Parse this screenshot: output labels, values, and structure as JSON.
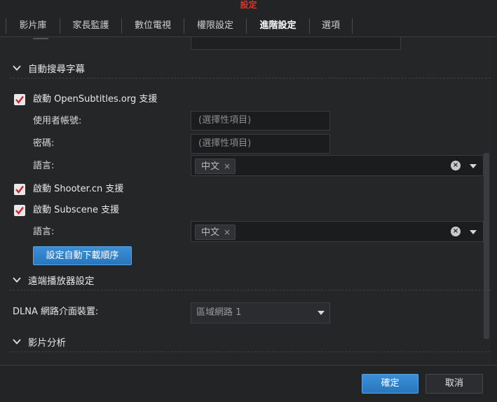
{
  "window": {
    "title": "設定"
  },
  "tabs": [
    {
      "label": "影片庫"
    },
    {
      "label": "家長監護"
    },
    {
      "label": "數位電視"
    },
    {
      "label": "權限設定"
    },
    {
      "label": "進階設定"
    },
    {
      "label": "選項"
    }
  ],
  "active_tab": "進階設定",
  "sections": {
    "auto_subtitle": {
      "title": "自動搜尋字幕"
    },
    "remote_player": {
      "title": "遠端播放器設定"
    },
    "video_analysis": {
      "title": "影片分析"
    }
  },
  "opensubtitles": {
    "checkbox_label": "啟動 OpenSubtitles.org 支援",
    "checked": true,
    "username_label": "使用者帳號:",
    "username_placeholder": "(選擇性項目)",
    "password_label": "密碼:",
    "password_placeholder": "(選擇性項目)",
    "language_label": "語言:",
    "language_tag": "中文"
  },
  "shooter": {
    "checkbox_label": "啟動 Shooter.cn 支援",
    "checked": true
  },
  "subscene": {
    "checkbox_label": "啟動 Subscene 支援",
    "checked": true,
    "language_label": "語言:",
    "language_tag": "中文"
  },
  "download_order_button": "設定自動下載順序",
  "dlna": {
    "label": "DLNA 網路介面裝置:",
    "selected": "區域網路 1"
  },
  "footer": {
    "ok": "確定",
    "cancel": "取消"
  },
  "icons": {
    "tag_remove": "×",
    "clear": "×",
    "chevron": "chevron-down-icon",
    "caret": "caret-down-icon",
    "check": "checkmark-icon"
  },
  "colors": {
    "title_red": "#e0302a",
    "primary_blue": "#2a7fc8",
    "checkmark_red": "#c8262a",
    "background": "#242628"
  }
}
